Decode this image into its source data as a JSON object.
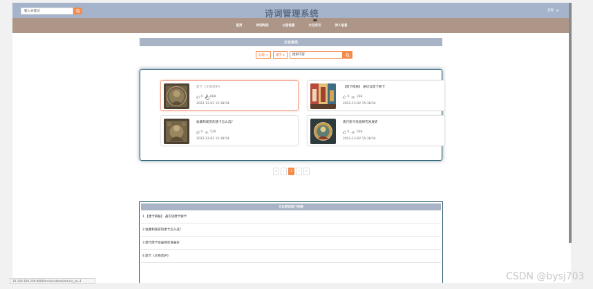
{
  "header": {
    "search_placeholder": "输入关键词",
    "title": "诗词管理系统",
    "user_label": "名称"
  },
  "nav": {
    "items": [
      {
        "label": "首页",
        "active": false
      },
      {
        "label": "诗词时间",
        "active": false
      },
      {
        "label": "公告信息",
        "active": false
      },
      {
        "label": "文化资讯",
        "active": true
      },
      {
        "label": "诗人信息",
        "active": false
      }
    ]
  },
  "section": {
    "title": "文化资讯"
  },
  "filters": {
    "dropdown1": "标题",
    "dropdown2": "排序",
    "search_placeholder": "搜索内容"
  },
  "articles": [
    {
      "title": "唐卡《文殊菩萨》",
      "likes": "0",
      "views": "888",
      "date": "2022-12-02 15:38:54",
      "hovered": true
    },
    {
      "title": "【唐卡揭秘】 通识读唐卡要卡",
      "likes": "0",
      "views": "288",
      "date": "2022-12-02 15:38:54",
      "hovered": false
    },
    {
      "title": "收藏和观赏的唐卡怎么选?",
      "likes": "0",
      "views": "529",
      "date": "2022-12-02 15:38:54",
      "hovered": false
    },
    {
      "title": "唐代唐卡绘画探究发展史",
      "likes": "0",
      "views": "586",
      "date": "2022-12-02 15:38:54",
      "hovered": false
    }
  ],
  "pagination": {
    "first": "«",
    "prev": "‹",
    "current": "1",
    "next": "›",
    "last": "»"
  },
  "hot": {
    "title": "文化资讯热门列表",
    "items": [
      "1 【唐卡揭秘】 通识读唐卡要卡",
      "2 收藏和观赏的唐卡怎么选?",
      "3 唐代唐卡绘画探究发展史",
      "4 唐卡《文殊菩萨》"
    ]
  },
  "status": {
    "url": "10.100.100.200:8080/article/detail/article_id=1"
  },
  "watermark": "CSDN @bysj703",
  "colors": {
    "topbar": "#a5b4cb",
    "navbar": "#ad9688",
    "accent": "#f38b4e",
    "panel_border": "#1f5467"
  }
}
